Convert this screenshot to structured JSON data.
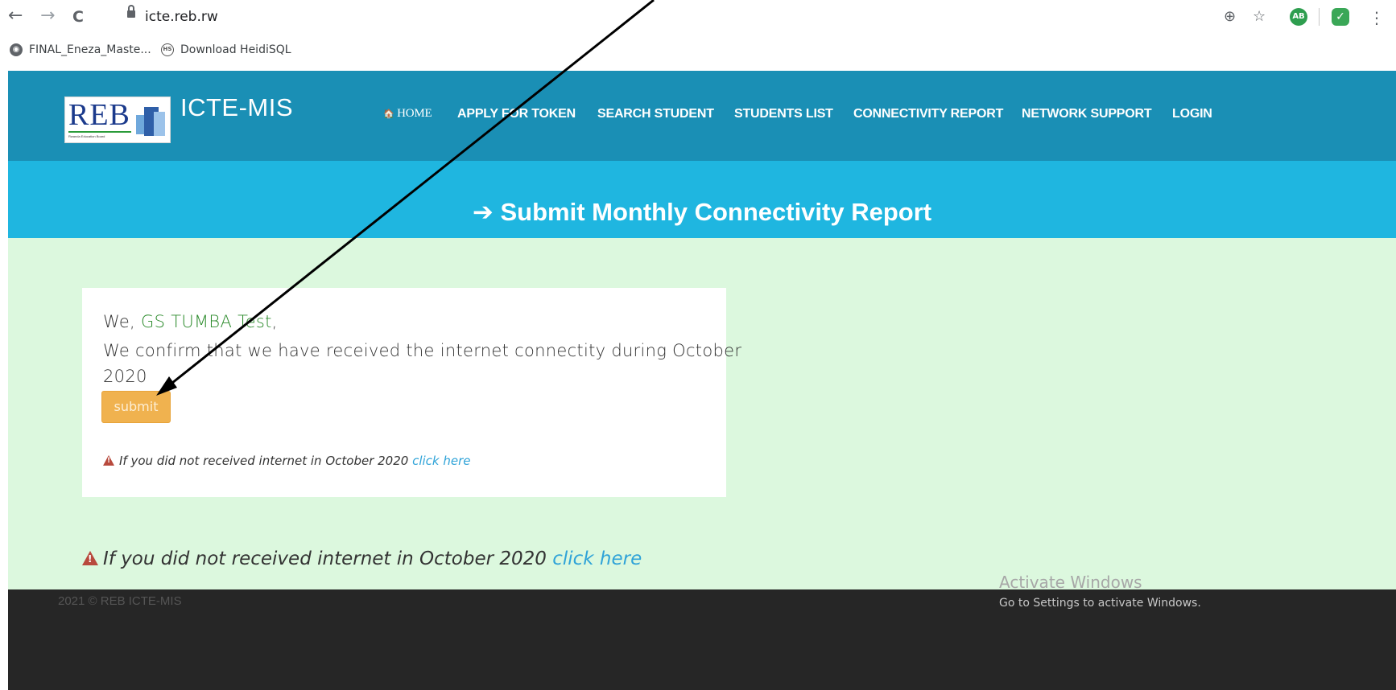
{
  "browser": {
    "url": "icte.reb.rw",
    "nav": {
      "back": "←",
      "forward": "→",
      "reload": "C"
    },
    "bookmarks": [
      {
        "label": "FINAL_Eneza_Maste..."
      },
      {
        "label": "Download HeidiSQL"
      }
    ],
    "right_icons": {
      "zoom": "⊕",
      "star": "☆",
      "ext_ab": "AB",
      "ext_shield": "✓",
      "menu": "⋮"
    }
  },
  "header": {
    "logo_text": "REB",
    "logo_tagline": "Rwanda Education Board",
    "brand": "ICTE-MIS",
    "menu": [
      {
        "icon": "🏠",
        "label": "HOME"
      },
      {
        "label": "APPLY FOR TOKEN"
      },
      {
        "label": "SEARCH STUDENT"
      },
      {
        "label": "STUDENTS LIST"
      },
      {
        "label": "CONNECTIVITY REPORT"
      },
      {
        "label": "NETWORK SUPPORT"
      },
      {
        "label": "LOGIN"
      }
    ]
  },
  "banner": {
    "arrow": "➔",
    "title": "Submit Monthly Connectivity Report"
  },
  "card": {
    "we_prefix": "We, ",
    "school": "GS TUMBA Test",
    "we_suffix": ",",
    "confirm_line1": "We confirm that we have received the internet connectity during October",
    "confirm_line2": "2020",
    "submit_label": "submit",
    "warning_text": "If you did not received internet in October 2020 ",
    "warning_link": "click here"
  },
  "page_warning": {
    "text": "If you did not received internet in October 2020 ",
    "link": "click here"
  },
  "footer": {
    "text": "2021 © REB ICTE-MIS"
  },
  "watermark": {
    "line1": "Activate Windows",
    "line2": "Go to Settings to activate Windows."
  },
  "colors": {
    "header": "#1a8fb5",
    "banner": "#1fb6e0",
    "content_bg": "#dcf8de",
    "submit": "#f0b24f",
    "link": "#2fa3d8",
    "footer": "#262626"
  }
}
